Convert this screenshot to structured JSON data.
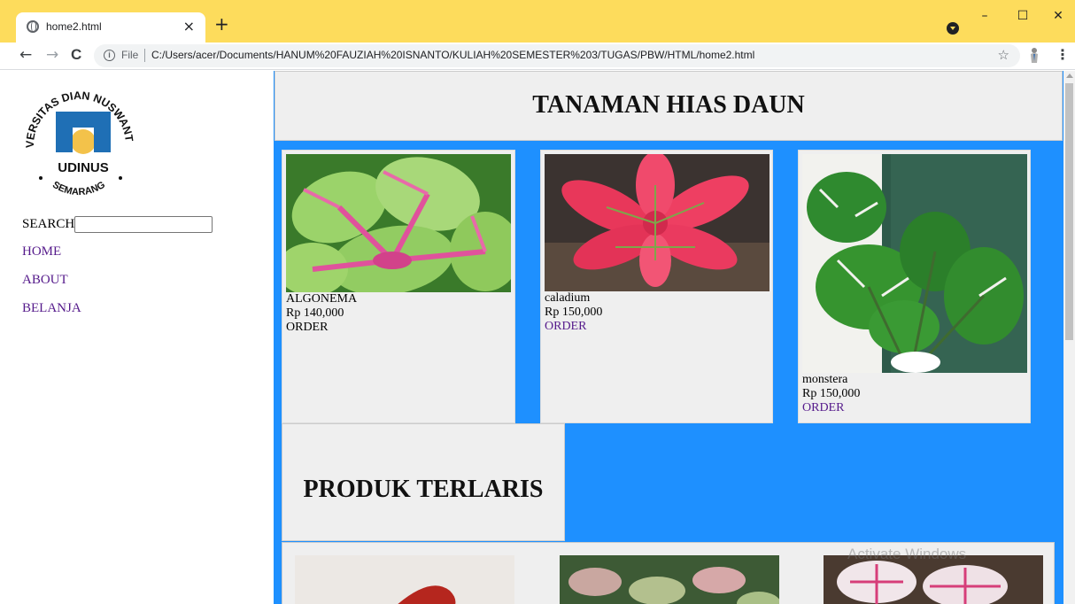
{
  "browser": {
    "tab_title": "home2.html",
    "tab_close": "×",
    "new_tab": "+",
    "window_minimize": "–",
    "window_maximize": "☐",
    "window_close": "✕",
    "back": "←",
    "forward": "→",
    "reload": "C",
    "scheme_label": "File",
    "url": "C:/Users/acer/Documents/HANUM%20FAUZIAH%20ISNANTO/KULIAH%20SEMESTER%203/TUGAS/PBW/HTML/home2.html",
    "bookmark_icon": "star-icon",
    "menu": "⋮"
  },
  "sidebar": {
    "logo": {
      "arc_top": "UNIVERSITAS DIAN NUSWANTORO",
      "arc_bottom": "SEMARANG",
      "name": "UDINUS",
      "colors": {
        "blue": "#1f6fb5",
        "yellow": "#f3c24a"
      }
    },
    "search_label": "SEARCH",
    "search_value": "",
    "nav": [
      {
        "label": "HOME"
      },
      {
        "label": "ABOUT"
      },
      {
        "label": "BELANJA"
      }
    ]
  },
  "main": {
    "title": "TANAMAN HIAS DAUN",
    "background_color": "#1e90ff",
    "products": [
      {
        "name": "ALGONEMA",
        "price": "Rp 140,000",
        "order": "ORDER"
      },
      {
        "name": "caladium",
        "price": "Rp 150,000",
        "order": "ORDER"
      },
      {
        "name": "monstera",
        "price": "Rp 150,000",
        "order": "ORDER"
      }
    ],
    "best_seller_title": "PRODUK TERLARIS"
  },
  "watermark": "Activate Windows"
}
